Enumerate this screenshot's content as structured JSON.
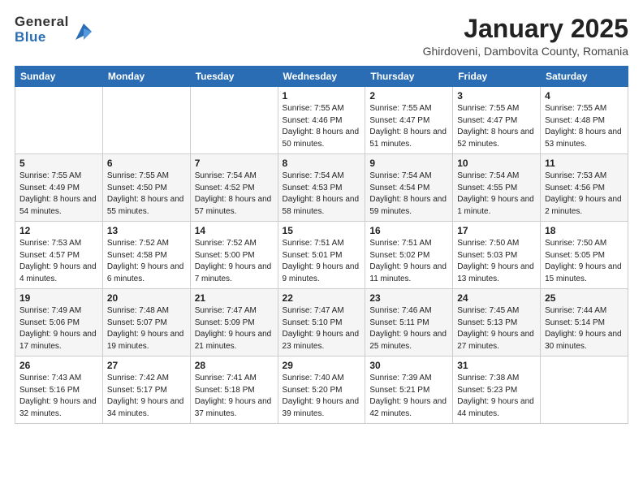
{
  "logo": {
    "general": "General",
    "blue": "Blue"
  },
  "header": {
    "month": "January 2025",
    "subtitle": "Ghirdoveni, Dambovita County, Romania"
  },
  "weekdays": [
    "Sunday",
    "Monday",
    "Tuesday",
    "Wednesday",
    "Thursday",
    "Friday",
    "Saturday"
  ],
  "weeks": [
    [
      {
        "day": "",
        "sunrise": "",
        "sunset": "",
        "daylight": ""
      },
      {
        "day": "",
        "sunrise": "",
        "sunset": "",
        "daylight": ""
      },
      {
        "day": "",
        "sunrise": "",
        "sunset": "",
        "daylight": ""
      },
      {
        "day": "1",
        "sunrise": "Sunrise: 7:55 AM",
        "sunset": "Sunset: 4:46 PM",
        "daylight": "Daylight: 8 hours and 50 minutes."
      },
      {
        "day": "2",
        "sunrise": "Sunrise: 7:55 AM",
        "sunset": "Sunset: 4:47 PM",
        "daylight": "Daylight: 8 hours and 51 minutes."
      },
      {
        "day": "3",
        "sunrise": "Sunrise: 7:55 AM",
        "sunset": "Sunset: 4:47 PM",
        "daylight": "Daylight: 8 hours and 52 minutes."
      },
      {
        "day": "4",
        "sunrise": "Sunrise: 7:55 AM",
        "sunset": "Sunset: 4:48 PM",
        "daylight": "Daylight: 8 hours and 53 minutes."
      }
    ],
    [
      {
        "day": "5",
        "sunrise": "Sunrise: 7:55 AM",
        "sunset": "Sunset: 4:49 PM",
        "daylight": "Daylight: 8 hours and 54 minutes."
      },
      {
        "day": "6",
        "sunrise": "Sunrise: 7:55 AM",
        "sunset": "Sunset: 4:50 PM",
        "daylight": "Daylight: 8 hours and 55 minutes."
      },
      {
        "day": "7",
        "sunrise": "Sunrise: 7:54 AM",
        "sunset": "Sunset: 4:52 PM",
        "daylight": "Daylight: 8 hours and 57 minutes."
      },
      {
        "day": "8",
        "sunrise": "Sunrise: 7:54 AM",
        "sunset": "Sunset: 4:53 PM",
        "daylight": "Daylight: 8 hours and 58 minutes."
      },
      {
        "day": "9",
        "sunrise": "Sunrise: 7:54 AM",
        "sunset": "Sunset: 4:54 PM",
        "daylight": "Daylight: 8 hours and 59 minutes."
      },
      {
        "day": "10",
        "sunrise": "Sunrise: 7:54 AM",
        "sunset": "Sunset: 4:55 PM",
        "daylight": "Daylight: 9 hours and 1 minute."
      },
      {
        "day": "11",
        "sunrise": "Sunrise: 7:53 AM",
        "sunset": "Sunset: 4:56 PM",
        "daylight": "Daylight: 9 hours and 2 minutes."
      }
    ],
    [
      {
        "day": "12",
        "sunrise": "Sunrise: 7:53 AM",
        "sunset": "Sunset: 4:57 PM",
        "daylight": "Daylight: 9 hours and 4 minutes."
      },
      {
        "day": "13",
        "sunrise": "Sunrise: 7:52 AM",
        "sunset": "Sunset: 4:58 PM",
        "daylight": "Daylight: 9 hours and 6 minutes."
      },
      {
        "day": "14",
        "sunrise": "Sunrise: 7:52 AM",
        "sunset": "Sunset: 5:00 PM",
        "daylight": "Daylight: 9 hours and 7 minutes."
      },
      {
        "day": "15",
        "sunrise": "Sunrise: 7:51 AM",
        "sunset": "Sunset: 5:01 PM",
        "daylight": "Daylight: 9 hours and 9 minutes."
      },
      {
        "day": "16",
        "sunrise": "Sunrise: 7:51 AM",
        "sunset": "Sunset: 5:02 PM",
        "daylight": "Daylight: 9 hours and 11 minutes."
      },
      {
        "day": "17",
        "sunrise": "Sunrise: 7:50 AM",
        "sunset": "Sunset: 5:03 PM",
        "daylight": "Daylight: 9 hours and 13 minutes."
      },
      {
        "day": "18",
        "sunrise": "Sunrise: 7:50 AM",
        "sunset": "Sunset: 5:05 PM",
        "daylight": "Daylight: 9 hours and 15 minutes."
      }
    ],
    [
      {
        "day": "19",
        "sunrise": "Sunrise: 7:49 AM",
        "sunset": "Sunset: 5:06 PM",
        "daylight": "Daylight: 9 hours and 17 minutes."
      },
      {
        "day": "20",
        "sunrise": "Sunrise: 7:48 AM",
        "sunset": "Sunset: 5:07 PM",
        "daylight": "Daylight: 9 hours and 19 minutes."
      },
      {
        "day": "21",
        "sunrise": "Sunrise: 7:47 AM",
        "sunset": "Sunset: 5:09 PM",
        "daylight": "Daylight: 9 hours and 21 minutes."
      },
      {
        "day": "22",
        "sunrise": "Sunrise: 7:47 AM",
        "sunset": "Sunset: 5:10 PM",
        "daylight": "Daylight: 9 hours and 23 minutes."
      },
      {
        "day": "23",
        "sunrise": "Sunrise: 7:46 AM",
        "sunset": "Sunset: 5:11 PM",
        "daylight": "Daylight: 9 hours and 25 minutes."
      },
      {
        "day": "24",
        "sunrise": "Sunrise: 7:45 AM",
        "sunset": "Sunset: 5:13 PM",
        "daylight": "Daylight: 9 hours and 27 minutes."
      },
      {
        "day": "25",
        "sunrise": "Sunrise: 7:44 AM",
        "sunset": "Sunset: 5:14 PM",
        "daylight": "Daylight: 9 hours and 30 minutes."
      }
    ],
    [
      {
        "day": "26",
        "sunrise": "Sunrise: 7:43 AM",
        "sunset": "Sunset: 5:16 PM",
        "daylight": "Daylight: 9 hours and 32 minutes."
      },
      {
        "day": "27",
        "sunrise": "Sunrise: 7:42 AM",
        "sunset": "Sunset: 5:17 PM",
        "daylight": "Daylight: 9 hours and 34 minutes."
      },
      {
        "day": "28",
        "sunrise": "Sunrise: 7:41 AM",
        "sunset": "Sunset: 5:18 PM",
        "daylight": "Daylight: 9 hours and 37 minutes."
      },
      {
        "day": "29",
        "sunrise": "Sunrise: 7:40 AM",
        "sunset": "Sunset: 5:20 PM",
        "daylight": "Daylight: 9 hours and 39 minutes."
      },
      {
        "day": "30",
        "sunrise": "Sunrise: 7:39 AM",
        "sunset": "Sunset: 5:21 PM",
        "daylight": "Daylight: 9 hours and 42 minutes."
      },
      {
        "day": "31",
        "sunrise": "Sunrise: 7:38 AM",
        "sunset": "Sunset: 5:23 PM",
        "daylight": "Daylight: 9 hours and 44 minutes."
      },
      {
        "day": "",
        "sunrise": "",
        "sunset": "",
        "daylight": ""
      }
    ]
  ]
}
